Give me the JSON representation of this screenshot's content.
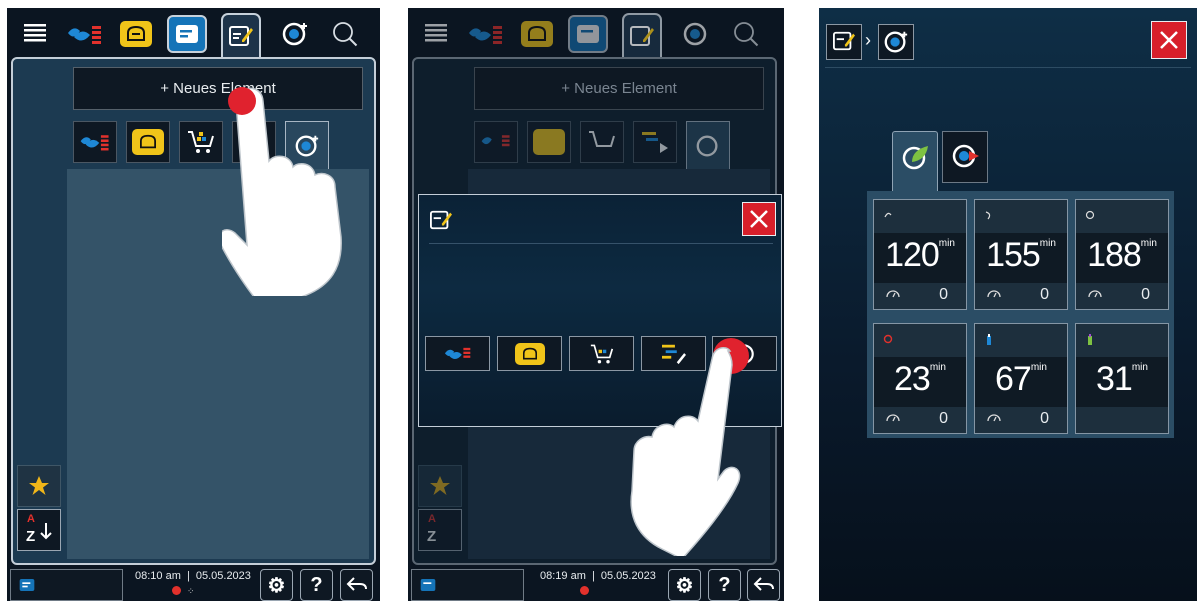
{
  "panel1": {
    "new_element_label": "+ Neues Element",
    "time": "08:10 am",
    "date": "05.05.2023",
    "separator": "|"
  },
  "panel2": {
    "new_element_label": "+ Neues Element",
    "time": "08:19 am",
    "date": "05.05.2023",
    "separator": "|"
  },
  "common": {
    "help_label": "?",
    "sort_label_top": "A",
    "sort_label_bottom": "Z"
  },
  "panel3": {
    "tabs": [
      "care-eco-icon",
      "care-fast-icon"
    ],
    "programs": [
      {
        "duration": "120",
        "unit": "min",
        "count": "0"
      },
      {
        "duration": "155",
        "unit": "min",
        "count": "0"
      },
      {
        "duration": "188",
        "unit": "min",
        "count": "0"
      },
      {
        "duration": "23",
        "unit": "min",
        "count": "0"
      },
      {
        "duration": "67",
        "unit": "min",
        "count": "0"
      },
      {
        "duration": "31",
        "unit": "min",
        "count": ""
      }
    ]
  },
  "colors": {
    "accent_blue": "#1574b8",
    "accent_yellow": "#f0c419",
    "close_red": "#d71f2a",
    "touch_red": "#e0222e"
  }
}
